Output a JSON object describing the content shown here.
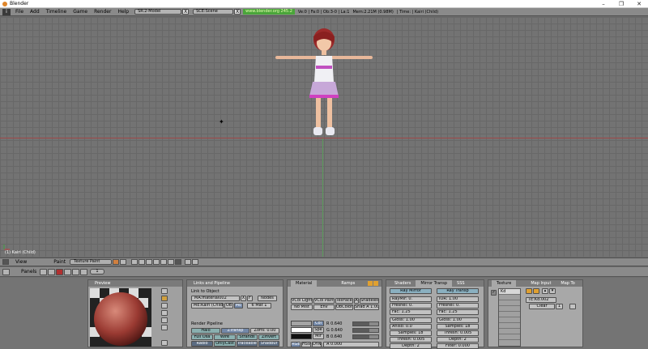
{
  "window": {
    "title": "Blender",
    "minimize": "–",
    "maximize": "❐",
    "close": "✕"
  },
  "menu": {
    "items": [
      "File",
      "Add",
      "Timeline",
      "Game",
      "Render",
      "Help"
    ],
    "screen_field": "SR:2-Model",
    "scene_field": "SCE:Scene",
    "x_label": "X",
    "url": "www.blender.org 245.2",
    "stats": "Ve:0 | Fa:0 | Ob:3-0 | La:1",
    "mem": "Mem:2.21M (0.98M)",
    "time": "| Time: | Kairi (Child)"
  },
  "viewport": {
    "object_label": "(1) Kairi (Child)"
  },
  "viewport_header": {
    "view_label": "View",
    "mode_label": "Paint",
    "mode_value": "Texture Paint"
  },
  "buttons_header": {
    "panels_label": "Panels",
    "frame_value": "1"
  },
  "preview": {
    "title": "Preview"
  },
  "links": {
    "title": "Links and Pipeline",
    "link_to_object": "Link to Object",
    "ma_field": "MA:material002",
    "x_btn": "X",
    "f_btn": "F",
    "nodes_btn": "Nodes",
    "me_field": "ME:Kairi (Child)",
    "ob_btn": "OB",
    "me_btn": "ME",
    "mat_field": "6 Mat 1",
    "render_pipeline": "Render Pipeline",
    "halo": "Halo",
    "ztransp": "ZTransp",
    "zoffs": "Zoffs: 0.00",
    "full_osa": "Full Osa",
    "wire": "Wire",
    "strands": "Strands",
    "zinvert": "ZInvert",
    "radio": "Radio",
    "only_cast": "OnlyCast",
    "traceable": "Traceable",
    "shadbuf": "Shadbuf"
  },
  "material": {
    "tab_material": "Material",
    "tab_ramps": "Ramps",
    "vcol_light": "VCol Light",
    "vcol_paint": "VCol Paint",
    "texface": "TexFace",
    "a_btn": "A",
    "shadeless": "Shadeless",
    "no_mist": "No Mist",
    "env": "Env",
    "obcolor": "ObColor",
    "shad_a": "Shad A 1.00",
    "col": "Col",
    "spe": "Spe",
    "mir": "Mir",
    "r": "R 0.640",
    "g": "G 0.640",
    "b": "B 0.640",
    "rgb": "RGB",
    "hsv": "HSV",
    "dyn": "DYN",
    "alpha": "A 0.000"
  },
  "mirror": {
    "tab_shaders": "Shaders",
    "tab_mirror": "Mirror Transp",
    "tab_sss": "SSS",
    "ray_mirror": "Ray Mirror",
    "ray_transp": "Ray Transp",
    "raymir": "RayMir: 0.",
    "fresnel": "Fresnel: 0.",
    "fac": "Fac: 1.25",
    "ior": "IOR: 1.00",
    "fresnel2": "Fresnel: 0.",
    "fac2": "Fac: 1.25",
    "gloss": "Gloss: 1.00",
    "aniso": "Aniso: 0.0",
    "samples": "Samples: 18",
    "thresh": "Thresh: 0.005",
    "depth": "Depth: 2",
    "gloss2": "Gloss: 1.00",
    "samples2": "Samples: 18",
    "thresh2": "Thresh: 0.005",
    "depth2": "Depth: 2",
    "filter": "Filter: 0.000"
  },
  "texture": {
    "tab_texture": "Texture",
    "tab_mapinput": "Map Input",
    "tab_mapto": "Map To",
    "slot1": "Kd",
    "te_field": "TE:Kd.002",
    "clear": "Clear",
    "users": "1"
  },
  "colors": {
    "accent": "#7388a8",
    "url_bg": "#4aa53a",
    "panel": "#a8a8a8"
  }
}
